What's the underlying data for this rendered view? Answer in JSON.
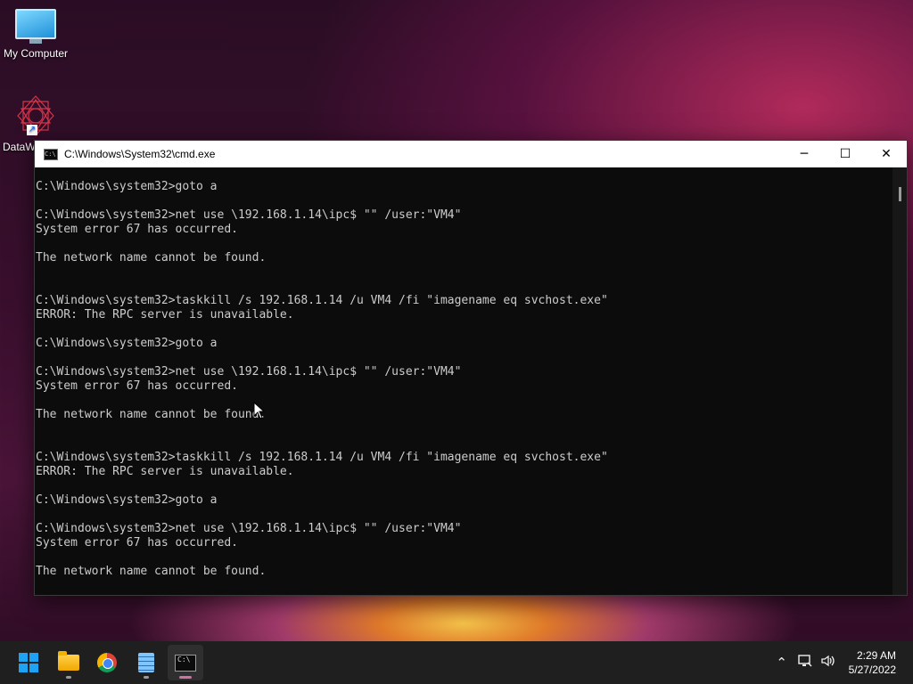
{
  "desktop": {
    "icons": [
      {
        "label": "My Computer",
        "icon": "monitor-icon"
      },
      {
        "label": "DataW",
        "icon": "datawrapper-icon"
      }
    ]
  },
  "cmd_window": {
    "title": "C:\\Windows\\System32\\cmd.exe",
    "controls": {
      "minimize": "─",
      "maximize": "☐",
      "close": "✕"
    },
    "console_text": "C:\\Windows\\system32>goto a\n\nC:\\Windows\\system32>net use \\192.168.1.14\\ipc$ \"\" /user:\"VM4\"\nSystem error 67 has occurred.\n\nThe network name cannot be found.\n\n\nC:\\Windows\\system32>taskkill /s 192.168.1.14 /u VM4 /fi \"imagename eq svchost.exe\"\nERROR: The RPC server is unavailable.\n\nC:\\Windows\\system32>goto a\n\nC:\\Windows\\system32>net use \\192.168.1.14\\ipc$ \"\" /user:\"VM4\"\nSystem error 67 has occurred.\n\nThe network name cannot be found.\n\n\nC:\\Windows\\system32>taskkill /s 192.168.1.14 /u VM4 /fi \"imagename eq svchost.exe\"\nERROR: The RPC server is unavailable.\n\nC:\\Windows\\system32>goto a\n\nC:\\Windows\\system32>net use \\192.168.1.14\\ipc$ \"\" /user:\"VM4\"\nSystem error 67 has occurred.\n\nThe network name cannot be found."
  },
  "taskbar": {
    "apps": [
      {
        "name": "start",
        "icon": "windows-logo-icon"
      },
      {
        "name": "file-explorer",
        "icon": "folder-icon"
      },
      {
        "name": "chrome",
        "icon": "chrome-icon"
      },
      {
        "name": "notepad",
        "icon": "notepad-icon"
      },
      {
        "name": "cmd",
        "icon": "terminal-icon",
        "active": true
      }
    ],
    "tray": {
      "icons": [
        "chevron-up-icon",
        "network-icon",
        "volume-icon"
      ],
      "time": "2:29 AM",
      "date": "5/27/2022"
    }
  }
}
